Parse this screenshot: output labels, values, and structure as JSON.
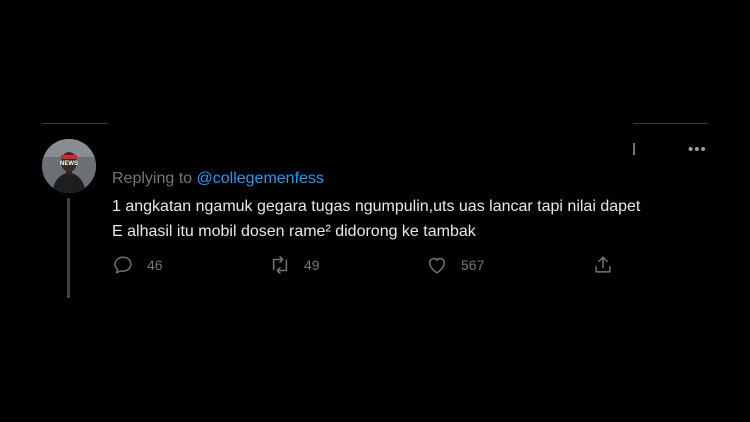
{
  "tweet": {
    "replying_prefix": "Replying to",
    "replying_handle": "@collegemenfess",
    "text_line1": "1 angkatan ngamuk gegara tugas ngumpulin,uts uas lancar tapi nilai dapet",
    "text_line2": "E alhasil itu mobil dosen rame² didorong ke tambak",
    "avatar_badge": "NEWS"
  },
  "actions": {
    "reply_count": "46",
    "retweet_count": "49",
    "like_count": "567"
  },
  "icons": {
    "reply": "comment-icon",
    "retweet": "retweet-icon",
    "like": "heart-icon",
    "share": "share-icon",
    "more": "more-icon"
  },
  "colors": {
    "background": "#000000",
    "text": "#e7e9ea",
    "muted": "#71767b",
    "link": "#1d9bf0"
  }
}
